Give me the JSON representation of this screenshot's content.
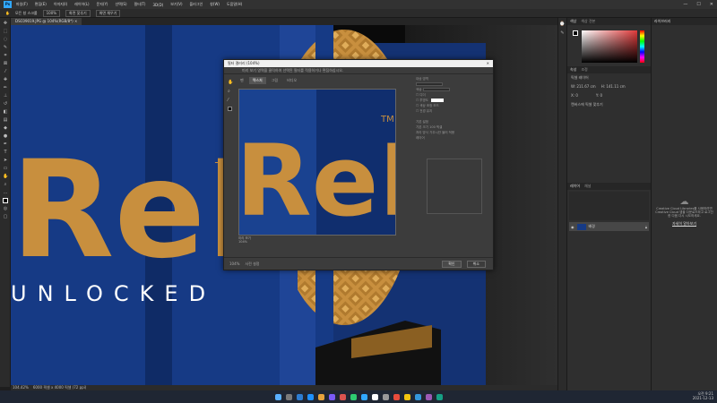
{
  "menubar": {
    "logo": "Ps",
    "items": [
      "파일(F)",
      "편집(E)",
      "이미지(I)",
      "레이어(L)",
      "문자(Y)",
      "선택(S)",
      "필터(T)",
      "3D(D)",
      "보기(V)",
      "플러그인",
      "창(W)",
      "도움말(H)"
    ],
    "win_min": "—",
    "win_max": "☐",
    "win_close": "✕"
  },
  "options": {
    "auto_select": "모든 창 스크롤",
    "zoom": "100%",
    "fit_screen": "화면 맞추기",
    "fill_screen": "화면 채우기"
  },
  "document": {
    "tab_title": "DSC09019.JPG @ 104%(RGB/8*)",
    "tab_close": "×",
    "zoom": "104.42%",
    "size": "6000 픽셀 x 4000 픽셀 (72 ppi)"
  },
  "canvas": {
    "brand_text": "ReRe",
    "tm": "TM",
    "subtitle": "UNLOCKED",
    "colors": {
      "blue": "#12347a",
      "gold": "#c88f3e",
      "dark": "#0a0a0a"
    }
  },
  "panels": {
    "color_tabs": [
      "색상",
      "색상 견본"
    ],
    "props_tabs": [
      "속성",
      "조정"
    ],
    "props_label": "픽셀 레이어",
    "w_label": "W: 211.67 cm",
    "h_label": "H: 141.11 cm",
    "x_label": "X: 0",
    "y_label": "Y: 0",
    "align_label": "캔버스에 픽셀 맞추기",
    "layers_tabs": [
      "레이어",
      "채널"
    ],
    "layer_name": "배경",
    "libs_tab": "라이브러리",
    "libs_message": "Creative Cloud Libraries를 사용하려면 Creative Cloud 앱을 다운로드하고 로그인한 다음 다시 시도하세요.",
    "libs_link": "자세히 알아보기",
    "accent": "#31a8ff"
  },
  "dialog": {
    "title": "필터 갤러리 (104%)",
    "close": "✕",
    "hint": "미리 보기 영역을 클릭하여 선택된 필터를 적용하거나 편집하십시오.",
    "tabs": [
      "펜",
      "텍스처",
      "그림",
      "비디오"
    ],
    "preview_info_1": "미리 보기",
    "preview_info_2": "104%",
    "section_1": "대상 영역",
    "option_color": "색상",
    "option_checkbox_1": "디더",
    "option_checkbox_2": "투명도",
    "option_checkbox_3": "색상 조정 모드",
    "option_checkbox_4": "전경 유지",
    "section_2": "기본 설정",
    "label_dim": "기본 크기",
    "value_dim": "100 픽셀",
    "label_method": "처리 방식",
    "value_method": "가우시안 블러 적용",
    "layers_label": "레이어",
    "foot_zoom": "104%",
    "ok": "확인",
    "cancel": "취소",
    "preset": "사전 설정"
  },
  "taskbar": {
    "tray_time": "오전 9:21",
    "tray_date": "2021-12-13",
    "icons": [
      "#5ab0ff",
      "#7a7a7a",
      "#2d7dd2",
      "#1e90ff",
      "#e6a23c",
      "#7a5af8",
      "#d9534f",
      "#2ecc71",
      "#31a8ff",
      "#ffffff",
      "#999999",
      "#e74c3c",
      "#f1c40f",
      "#3498db",
      "#9b59b6",
      "#16a085"
    ]
  }
}
